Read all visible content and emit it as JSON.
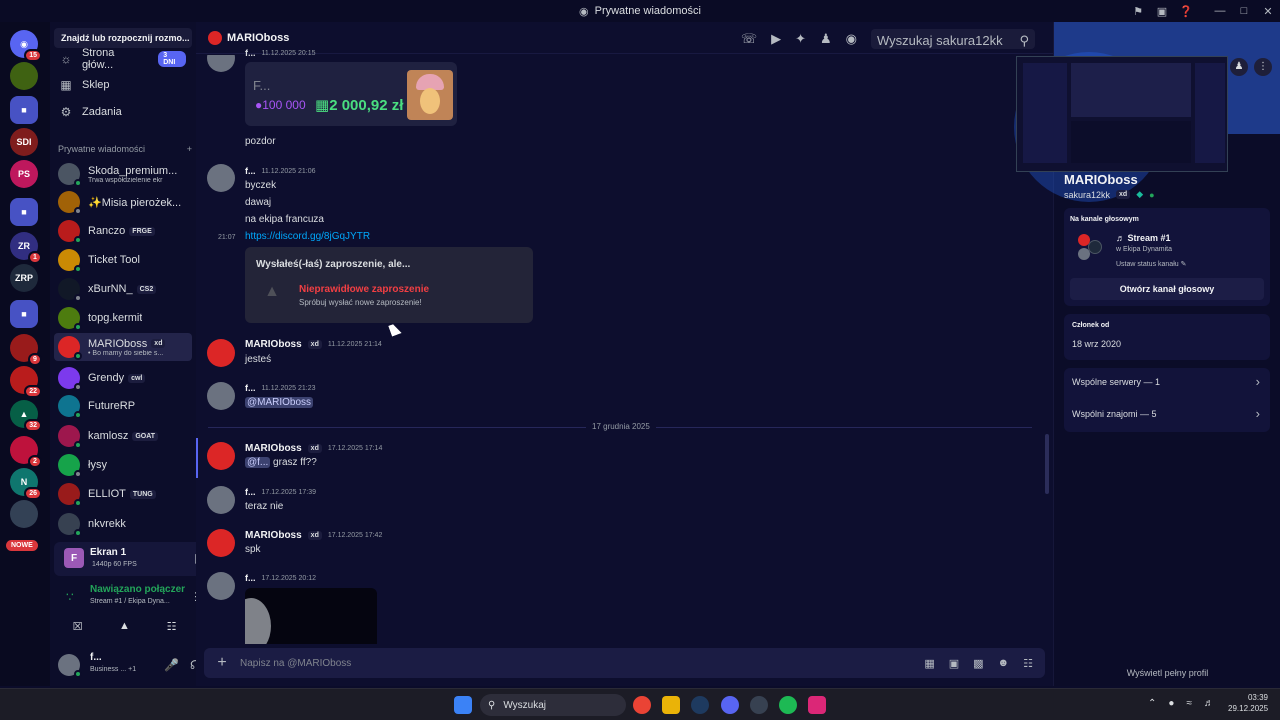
{
  "window": {
    "title": "Prywatne wiadomości"
  },
  "dm_sidebar": {
    "search_placeholder": "Znajdź lub rozpocznij rozmo...",
    "nav": [
      {
        "label": "Strona głów...",
        "pill": "3 DNI"
      },
      {
        "label": "Sklep"
      },
      {
        "label": "Zadania"
      }
    ],
    "section_title": "Prywatne wiadomości",
    "conversations": [
      {
        "name": "Skoda_premium...",
        "sub": "Trwa współdzielenie ekr",
        "color": "#4b5563"
      },
      {
        "name": "✨Misia pierożek...",
        "sub": "",
        "color": "#a16207"
      },
      {
        "name": "Ranczo",
        "tag": "FRGE",
        "sub": "",
        "color": "#b91c1c"
      },
      {
        "name": "Ticket Tool",
        "sub": "",
        "color": "#ca8a04"
      },
      {
        "name": "xBurNN_",
        "tag": "CS2",
        "sub": "",
        "color": "#111827"
      },
      {
        "name": "topg.kermit",
        "sub": "",
        "color": "#4d7c0f"
      },
      {
        "name": "MARIOboss",
        "tag": "xd",
        "sub": "• Bo mamy do siebie s...",
        "color": "#dc2626"
      },
      {
        "name": "Grendy",
        "tag": "cwl",
        "sub": "",
        "color": "#7c3aed"
      },
      {
        "name": "FutureRP",
        "sub": "",
        "color": "#0e7490"
      },
      {
        "name": "kamlosz",
        "tag": "GOAT",
        "sub": "",
        "color": "#9d174d"
      },
      {
        "name": "łysy",
        "sub": "",
        "color": "#16a34a"
      },
      {
        "name": "ELLIOT",
        "tag": "TUNG",
        "sub": "",
        "color": "#991b1b"
      },
      {
        "name": "nkvrekk",
        "sub": "",
        "color": "#374151"
      }
    ],
    "screen_share": {
      "title": "Ekran 1",
      "quality": "1440p 60 FPS"
    },
    "voice": {
      "status": "Nawiązano połączer",
      "channel": "Stream #1 / Ekipa Dyna..."
    },
    "user": {
      "name": "f...",
      "status": "Business ...",
      "extra": "+1"
    }
  },
  "server_rail": {
    "badges": [
      "15",
      "1",
      "9",
      "22",
      "32",
      "2",
      "26"
    ],
    "new_label": "NOWE"
  },
  "chat": {
    "channel_name": "MARIOboss",
    "search_placeholder": "Wyszukaj sakura12kk",
    "top_author": "f...",
    "top_timestamp": "11.12.2025 20:15",
    "card_label": "F...",
    "card_credits": "100 000",
    "card_money": "2 000,92 zł",
    "messages": [
      {
        "text": "pozdor"
      },
      {
        "author": "f...",
        "time": "11.12.2025 21:06",
        "lines": [
          "byczek",
          "dawaj",
          "na ekipa francuza"
        ]
      },
      {
        "side_time": "21:07",
        "link": "https://discord.gg/8jGqJYTR"
      }
    ],
    "invite": {
      "title": "Wysłałeś(-łaś) zaproszenie, ale...",
      "error": "Nieprawidłowe zaproszenie",
      "hint": "Spróbuj wysłać nowe zaproszenie!"
    },
    "m_mario_1": {
      "author": "MARIOboss",
      "tag": "xd",
      "time": "11.12.2025 21:14",
      "text": "jesteś"
    },
    "m_f_2": {
      "author": "f...",
      "time": "11.12.2025 21:23",
      "text": "@MARIOboss"
    },
    "date_divider": "17 grudnia 2025",
    "m_mario_2": {
      "author": "MARIOboss",
      "tag": "xd",
      "time": "17.12.2025 17:14",
      "mention": "@f...",
      "text": "grasz ff??"
    },
    "m_f_3": {
      "author": "f...",
      "time": "17.12.2025 17:39",
      "text": "teraz nie"
    },
    "m_mario_3": {
      "author": "MARIOboss",
      "tag": "xd",
      "time": "17.12.2025 17:42",
      "text": "spk"
    },
    "m_f_4": {
      "author": "f...",
      "time": "17.12.2025 20:12"
    },
    "composer_placeholder": "Napisz na @MARIOboss"
  },
  "profile": {
    "display_name": "MARIOboss",
    "username": "sakura12kk",
    "tag": "xd",
    "voice_section": "Na kanale głosowym",
    "voice_channel": "Stream #1",
    "voice_server": "w Ekipa Dynamita",
    "voice_status": "Ustaw status kanału",
    "open_voice": "Otwórz kanał głosowy",
    "member_since_label": "Członek od",
    "member_since": "18 wrz 2020",
    "mutual_servers": "Wspólne serwery — 1",
    "mutual_friends": "Wspólni znajomi — 5",
    "view_full": "Wyświetl pełny profil"
  },
  "taskbar": {
    "search": "Wyszukaj",
    "time": "03:39",
    "date": "29.12.2025"
  }
}
